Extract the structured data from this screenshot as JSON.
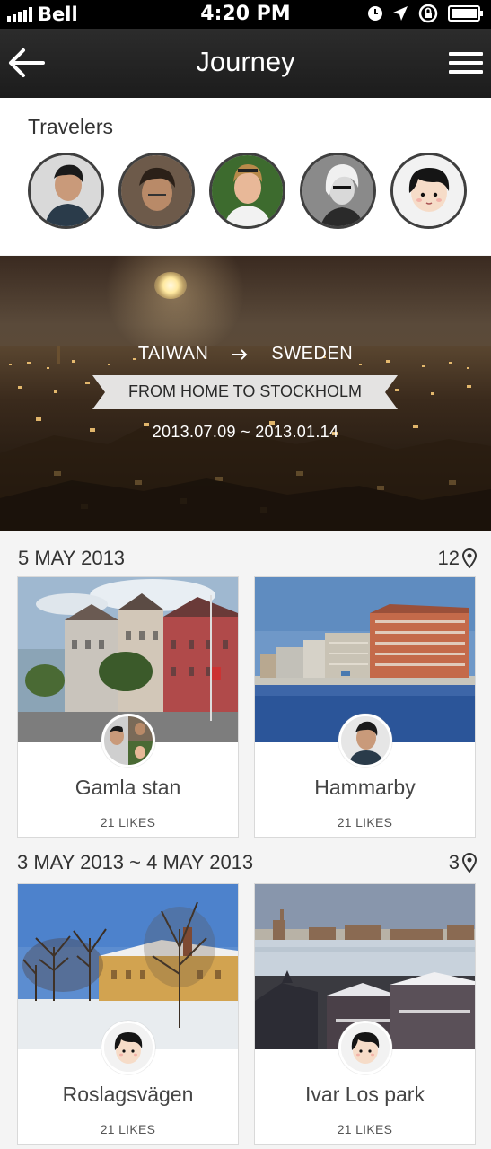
{
  "status_bar": {
    "carrier": "Bell",
    "time": "4:20 PM"
  },
  "nav": {
    "title": "Journey"
  },
  "travelers": {
    "heading": "Travelers",
    "avatars": [
      "traveler-1",
      "traveler-2",
      "traveler-3",
      "traveler-4",
      "traveler-5"
    ]
  },
  "hero": {
    "from": "TAIWAN",
    "to": "SWEDEN",
    "title": "FROM HOME TO STOCKHOLM",
    "dates": "2013.07.09 ~ 2013.01.14"
  },
  "sections": [
    {
      "date": "5 MAY 2013",
      "count": "12",
      "cards": [
        {
          "name": "Gamla stan",
          "likes": "21 LIKES"
        },
        {
          "name": "Hammarby",
          "likes": "21 LIKES"
        }
      ]
    },
    {
      "date": "3 MAY 2013 ~ 4 MAY 2013",
      "count": "3",
      "cards": [
        {
          "name": "Roslagsvägen",
          "likes": "21 LIKES"
        },
        {
          "name": "Ivar Los park",
          "likes": "21 LIKES"
        }
      ]
    }
  ],
  "colors": {
    "navbar": "#222222",
    "accent": "#ffffff",
    "background": "#f4f4f4"
  }
}
